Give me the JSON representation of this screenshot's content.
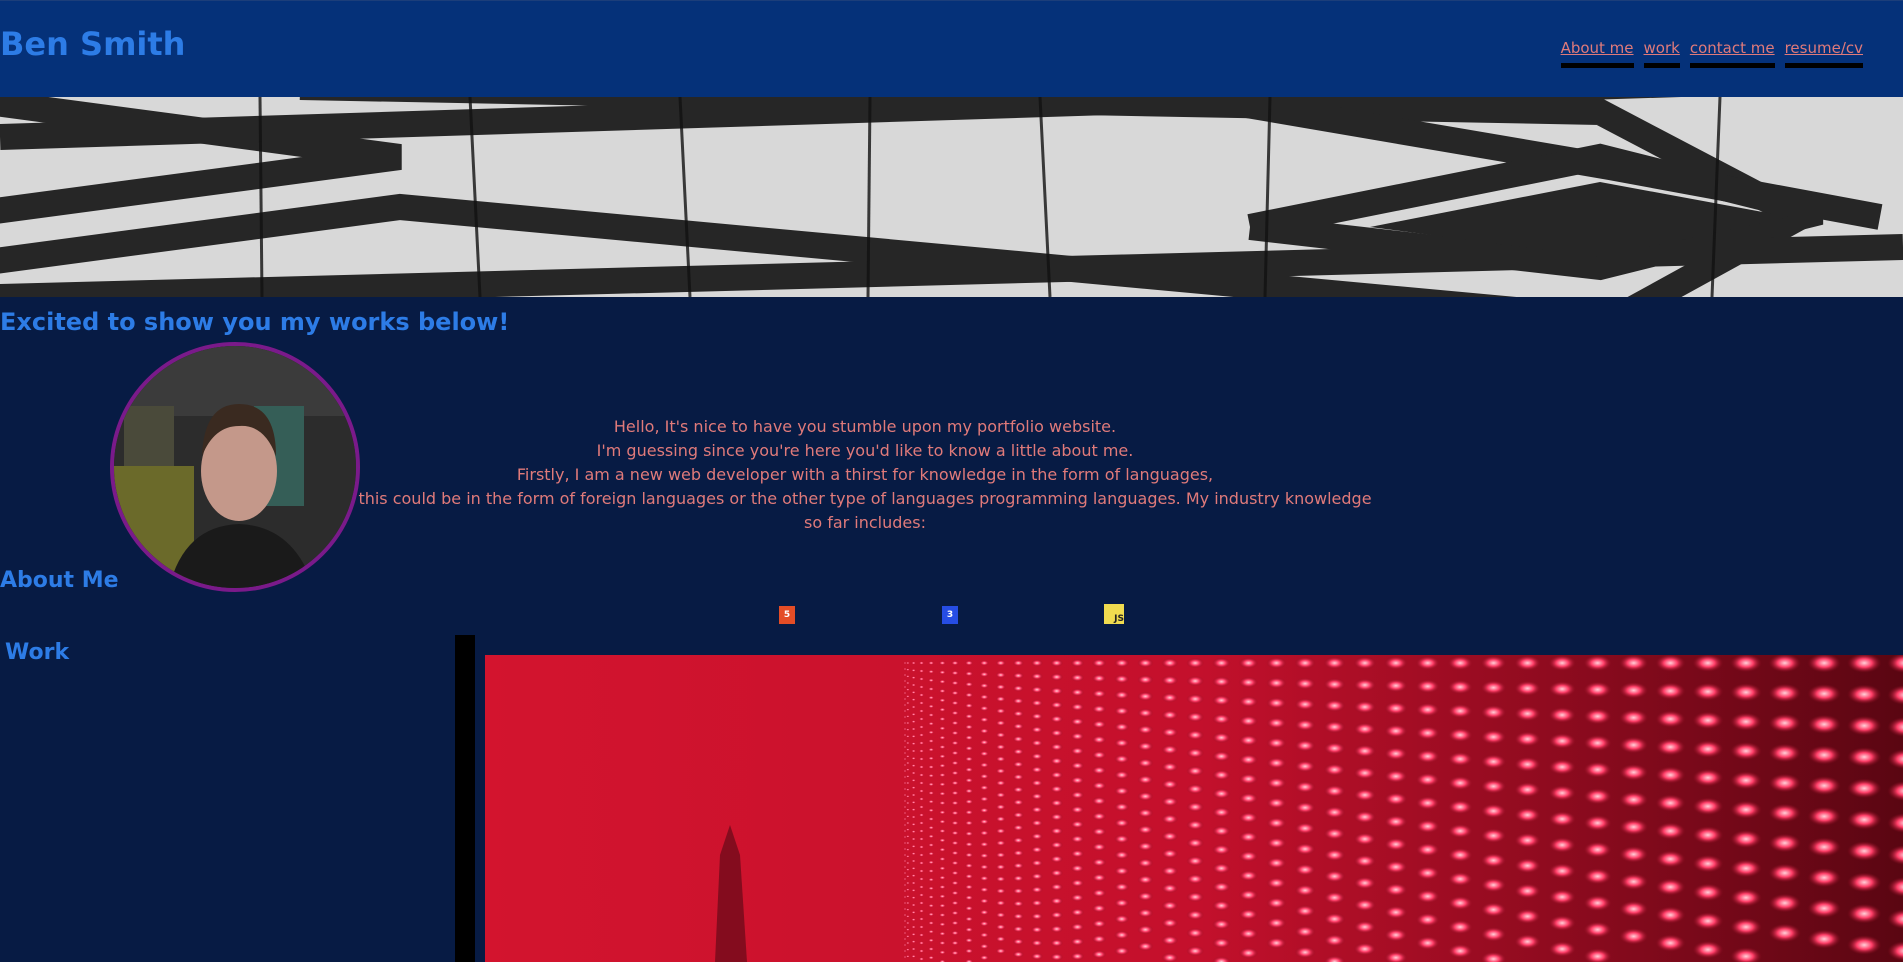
{
  "header": {
    "title": "Ben Smith",
    "nav": [
      "About me",
      "work",
      "contact me",
      "resume/cv"
    ]
  },
  "hero": {
    "tagline": "Excited to show you my works below!"
  },
  "about": {
    "intro_lines": [
      "Hello, It's nice to have you stumble upon my portfolio website.",
      "I'm guessing since you're here you'd like to know a little about me.",
      "Firstly, I am a new web developer with a thirst for knowledge in the form of languages,",
      "this could be in the form of foreign languages or the other type of languages programming languages. My industry knowledge so far includes:"
    ],
    "heading": "About Me",
    "tech_icons": [
      {
        "name": "html5-icon",
        "glyph": "5",
        "color": "#e44d26"
      },
      {
        "name": "css3-icon",
        "glyph": "3",
        "color": "#264de4"
      },
      {
        "name": "javascript-icon",
        "glyph": "JS",
        "color": "#f0db4f"
      }
    ]
  },
  "work": {
    "heading": "Work"
  },
  "colors": {
    "background": "#071b44",
    "header": "#053179",
    "accent": "#2d7ce6",
    "text": "#e07a7a"
  }
}
